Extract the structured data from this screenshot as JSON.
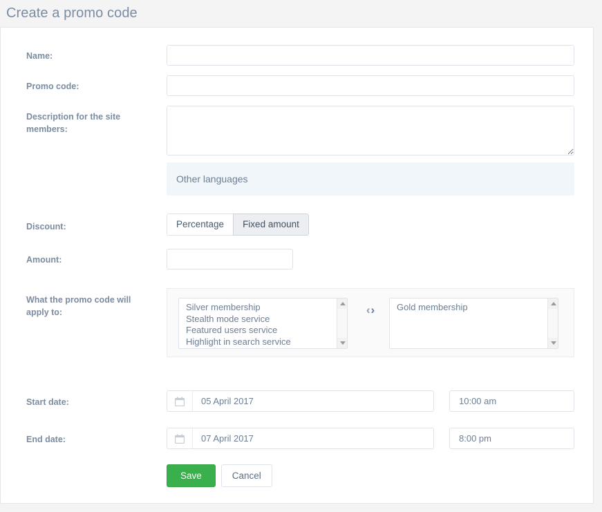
{
  "page": {
    "title": "Create a promo code",
    "title_color": "#7a8ca3",
    "background_color": "#f4f4f5",
    "card_background": "#ffffff"
  },
  "form": {
    "name": {
      "label": "Name:",
      "value": "",
      "placeholder": ""
    },
    "promo_code": {
      "label": "Promo code:",
      "value": "",
      "placeholder": ""
    },
    "description": {
      "label": "Description for the site members:",
      "label_line1": "Description for the site",
      "label_line2": "members:",
      "value": "",
      "placeholder": ""
    },
    "other_languages": {
      "label": "Other languages",
      "background_color": "#f1f6fa"
    },
    "discount": {
      "label": "Discount:",
      "options": [
        {
          "label": "Percentage",
          "selected": false
        },
        {
          "label": "Fixed amount",
          "selected": true
        }
      ]
    },
    "amount": {
      "label": "Amount:",
      "value": "",
      "placeholder": ""
    },
    "apply_to": {
      "label": "What the promo code will apply to:",
      "label_line1": "What the promo code will",
      "label_line2": "apply to:",
      "available": [
        "Silver membership",
        "Stealth mode service",
        "Featured users service",
        "Highlight in search service"
      ],
      "selected": [
        "Gold membership"
      ],
      "transfer_left_icon": "chevron-left-icon",
      "transfer_right_icon": "chevron-right-icon",
      "transfer_left_glyph": "‹",
      "transfer_right_glyph": "›"
    },
    "start_date": {
      "label": "Start date:",
      "date": "05 April 2017",
      "time": "10:00 am",
      "icon": "calendar-icon"
    },
    "end_date": {
      "label": "End date:",
      "date": "07 April 2017",
      "time": "8:00 pm",
      "icon": "calendar-icon"
    }
  },
  "actions": {
    "save_label": "Save",
    "save_color": "#39b04b",
    "cancel_label": "Cancel"
  }
}
